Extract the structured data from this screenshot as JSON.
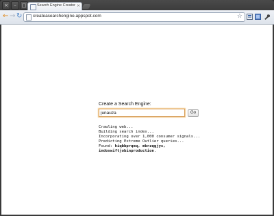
{
  "browser": {
    "window_controls": [
      "×",
      "–",
      "□"
    ],
    "tab": {
      "title": "Search Engine Creator",
      "close": "×"
    },
    "nav": {
      "back": "←",
      "forward": "→",
      "reload": "↻"
    },
    "address_bar": {
      "url": "createasearchengine.appspot.com",
      "star": "☆"
    },
    "toolbar_icons": [
      "page-menu-icon",
      "tools-icon",
      "wrench-icon"
    ]
  },
  "page": {
    "label": "Create a Search Engine:",
    "search": {
      "value": "junauza"
    },
    "go_button": "Go",
    "log": {
      "line1": "Crawling web...",
      "line2": "Building search index...",
      "line3": "Incorporating over 1,000 consumer signals...",
      "line4": "Predicting Extreme Outlier queries...",
      "found_prefix": "Found: ",
      "found_bold_1": "hiqbbprqeq, mbrzqgjys,",
      "found_bold_2": "indoswiftjobinproduction",
      "found_suffix": "."
    }
  }
}
